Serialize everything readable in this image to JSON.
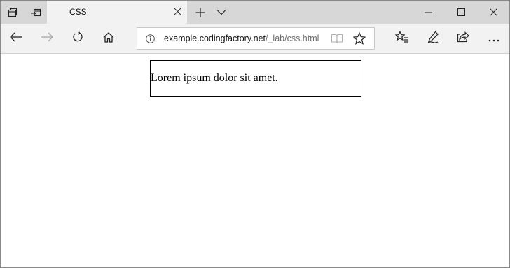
{
  "browser": {
    "tab": {
      "title": "CSS"
    },
    "address": {
      "domain": "example.codingfactory.net",
      "path": "/_lab/css.html"
    }
  },
  "icons": [
    "tab-preview-icon",
    "set-aside-tabs-icon",
    "close-icon",
    "new-tab-icon",
    "chevron-down-icon",
    "minimize-icon",
    "maximize-icon",
    "window-close-icon",
    "back-icon",
    "forward-icon",
    "refresh-icon",
    "home-icon",
    "info-icon",
    "reading-view-icon",
    "favorite-star-icon",
    "favorites-list-icon",
    "pen-icon",
    "share-icon",
    "more-icon"
  ],
  "page": {
    "box_text": "Lorem ipsum dolor sit amet."
  }
}
